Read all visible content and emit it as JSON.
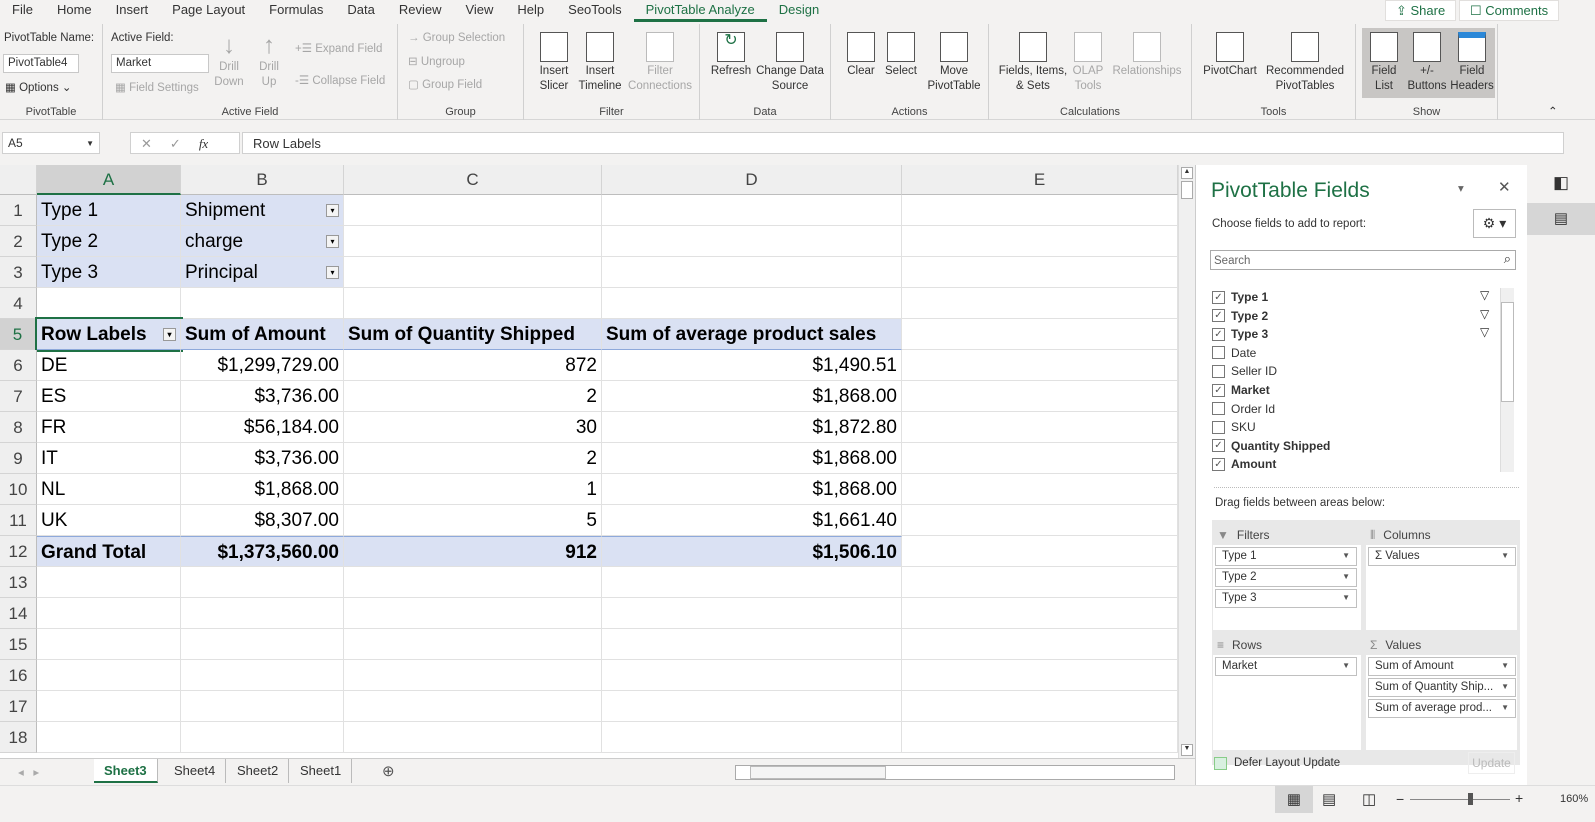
{
  "menu": {
    "tabs": [
      "File",
      "Home",
      "Insert",
      "Page Layout",
      "Formulas",
      "Data",
      "Review",
      "View",
      "Help",
      "SeoTools",
      "PivotTable Analyze",
      "Design"
    ],
    "active": "PivotTable Analyze",
    "share": "Share",
    "comments": "Comments"
  },
  "ribbon": {
    "pivottable": {
      "name_label": "PivotTable Name:",
      "name_value": "PivotTable4",
      "options": "Options",
      "group": "PivotTable"
    },
    "active_field": {
      "label": "Active Field:",
      "value": "Market",
      "field_settings": "Field Settings",
      "drill_down": "Drill Down",
      "drill_up": "Drill Up",
      "expand": "Expand Field",
      "collapse": "Collapse Field",
      "group": "Active Field"
    },
    "group": {
      "group_selection": "Group Selection",
      "ungroup": "Ungroup",
      "group_field": "Group Field",
      "group": "Group"
    },
    "filter": {
      "insert_slicer": "Insert Slicer",
      "insert_timeline": "Insert Timeline",
      "filter_connections": "Filter Connections",
      "group": "Filter"
    },
    "data": {
      "refresh": "Refresh",
      "change_source": "Change Data Source",
      "group": "Data"
    },
    "actions": {
      "clear": "Clear",
      "select": "Select",
      "move": "Move PivotTable",
      "group": "Actions"
    },
    "calculations": {
      "fields": "Fields, Items, & Sets",
      "olap": "OLAP Tools",
      "relationships": "Relationships",
      "group": "Calculations"
    },
    "tools": {
      "pivotchart": "PivotChart",
      "recommended": "Recommended PivotTables",
      "group": "Tools"
    },
    "show": {
      "field_list": "Field List",
      "buttons": "+/- Buttons",
      "headers": "Field Headers",
      "group": "Show"
    }
  },
  "formula_bar": {
    "cell_ref": "A5",
    "fx": "fx",
    "content": "Row Labels"
  },
  "grid": {
    "columns": [
      "A",
      "B",
      "C",
      "D",
      "E"
    ],
    "selected_col": "A",
    "selected_row": 5,
    "rows": [
      [
        "Type 1",
        "Shipment",
        "",
        "",
        ""
      ],
      [
        "Type 2",
        "charge",
        "",
        "",
        ""
      ],
      [
        "Type 3",
        "Principal",
        "",
        "",
        ""
      ],
      [
        "",
        "",
        "",
        "",
        ""
      ],
      [
        "Row Labels",
        "Sum of Amount",
        "Sum of Quantity Shipped",
        "Sum of average product sales",
        ""
      ],
      [
        "DE",
        "$1,299,729.00",
        "872",
        "$1,490.51",
        ""
      ],
      [
        "ES",
        "$3,736.00",
        "2",
        "$1,868.00",
        ""
      ],
      [
        "FR",
        "$56,184.00",
        "30",
        "$1,872.80",
        ""
      ],
      [
        "IT",
        "$3,736.00",
        "2",
        "$1,868.00",
        ""
      ],
      [
        "NL",
        "$1,868.00",
        "1",
        "$1,868.00",
        ""
      ],
      [
        "UK",
        "$8,307.00",
        "5",
        "$1,661.40",
        ""
      ],
      [
        "Grand Total",
        "$1,373,560.00",
        "912",
        "$1,506.10",
        ""
      ],
      [
        "",
        "",
        "",
        "",
        ""
      ],
      [
        "",
        "",
        "",
        "",
        ""
      ],
      [
        "",
        "",
        "",
        "",
        ""
      ],
      [
        "",
        "",
        "",
        "",
        ""
      ],
      [
        "",
        "",
        "",
        "",
        ""
      ],
      [
        "",
        "",
        "",
        "",
        ""
      ]
    ]
  },
  "sheets": {
    "tabs": [
      "Sheet3",
      "Sheet4",
      "Sheet2",
      "Sheet1"
    ],
    "active": "Sheet3"
  },
  "pane": {
    "title": "PivotTable Fields",
    "subtitle": "Choose fields to add to report:",
    "search_placeholder": "Search",
    "fields": [
      {
        "name": "Type 1",
        "checked": true,
        "filter": true
      },
      {
        "name": "Type 2",
        "checked": true,
        "filter": true
      },
      {
        "name": "Type 3",
        "checked": true,
        "filter": true
      },
      {
        "name": "Date",
        "checked": false
      },
      {
        "name": "Seller ID",
        "checked": false
      },
      {
        "name": "Market",
        "checked": true
      },
      {
        "name": "Order Id",
        "checked": false
      },
      {
        "name": "SKU",
        "checked": false
      },
      {
        "name": "Quantity Shipped",
        "checked": true
      },
      {
        "name": "Amount",
        "checked": true
      }
    ],
    "drag_label": "Drag fields between areas below:",
    "filters": {
      "label": "Filters",
      "items": [
        "Type 1",
        "Type 2",
        "Type 3"
      ]
    },
    "columns": {
      "label": "Columns",
      "items": [
        "Σ Values"
      ]
    },
    "rows": {
      "label": "Rows",
      "items": [
        "Market"
      ]
    },
    "values": {
      "label": "Values",
      "items": [
        "Sum of Amount",
        "Sum of Quantity Ship...",
        "Sum of average prod..."
      ]
    },
    "defer": "Defer Layout Update",
    "update": "Update"
  },
  "status": {
    "zoom": "160%",
    "zoom_level": 160
  },
  "colors": {
    "accent": "#1e7145",
    "pivot_header": "#dae1f3"
  }
}
